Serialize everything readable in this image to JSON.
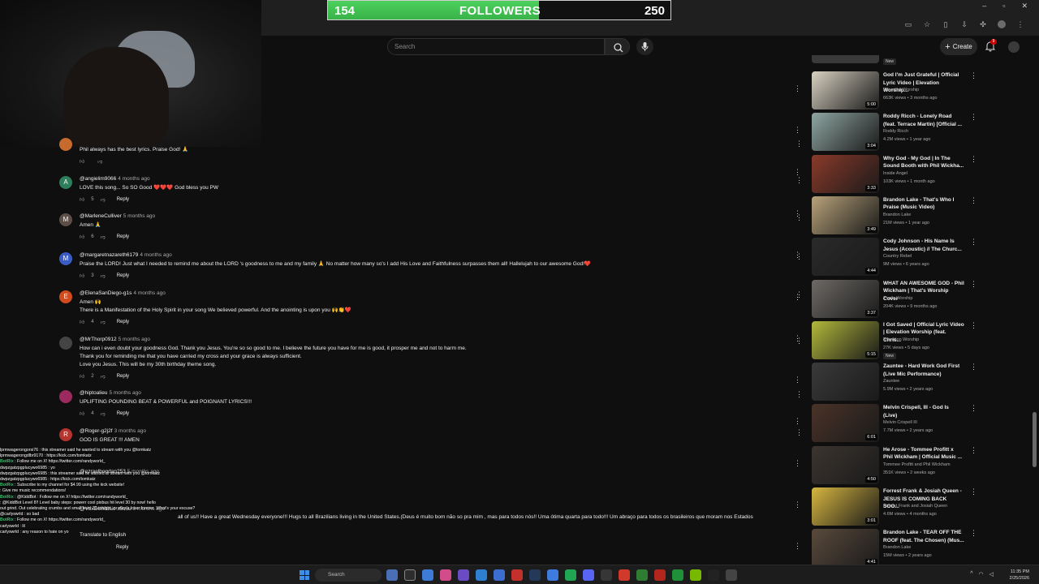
{
  "overlay": {
    "followers": {
      "current": "154",
      "label": "FOLLOWERS",
      "goal": "250",
      "progress": 0.616
    }
  },
  "header": {
    "search_placeholder": "Search",
    "create_label": "Create",
    "notification_count": "9"
  },
  "comments": [
    {
      "user": "",
      "time": "",
      "text": [
        "Phil always has the best lyrics. Praise God! 🙏"
      ],
      "likes": "",
      "initial": "",
      "color": "#c66a2e"
    },
    {
      "user": "@angielim9066",
      "time": "4 months ago",
      "text": [
        "LOVE this song... So SO Good ❤️❤️❤️ God bless you PW"
      ],
      "likes": "5",
      "initial": "A",
      "color": "#2e7d5b"
    },
    {
      "user": "@MarleneCulliver",
      "time": "5 months ago",
      "text": [
        "Amen 🙏"
      ],
      "likes": "6",
      "initial": "M",
      "color": "#5d4e48"
    },
    {
      "user": "@margaretnazareth6179",
      "time": "4 months ago",
      "text": [
        "Praise the LORD! Just what I needed to remind me about the LORD 's goodness to me and my family 🙏 No matter how many so's I add His Love and Faithfulness surpasses them all! Hallelujah to our awesome God!❤️"
      ],
      "likes": "3",
      "initial": "M",
      "color": "#3b5cc4"
    },
    {
      "user": "@ElenaSanDiego-g1s",
      "time": "4 months ago",
      "text": [
        "Amen 🙌",
        "There is a Manifestation of the Holy Spirit in your song We believed powerful. And the anointing is upon you 🙌👏❤️"
      ],
      "likes": "4",
      "initial": "E",
      "color": "#d14b1f"
    },
    {
      "user": "@MrThorp0912",
      "time": "5 months ago",
      "text": [
        "How can i even doubt your goodness God. Thank you Jesus. You're so so good to me. I believe the future you have for me is good, it prosper me and not to harm me.",
        "Thank you for reminding me that you have carried my cross and your grace is always sufficient.",
        "Love you Jesus. This will be my 30th birthday theme song."
      ],
      "likes": "2",
      "initial": "",
      "color": "#444"
    },
    {
      "user": "@hiptoalieu",
      "time": "5 months ago",
      "text": [
        "UPLIFTING POUNDING BEAT & POWERFUL and POIGNANT LYRICS!!!"
      ],
      "likes": "4",
      "initial": "",
      "color": "#9c2a5e"
    },
    {
      "user": "@Roger-g2j2f",
      "time": "3 months ago",
      "text": [
        "GOD IS GREAT !!! AMEN"
      ],
      "likes": "",
      "initial": "R",
      "color": "#b5342e"
    }
  ],
  "comments_extra": {
    "user1": "@ezraelbogdan253",
    "user1_time": "5 months ago",
    "user2": "@VoxDeiMusic-x5c6u",
    "user2_time": "3 months ago",
    "long_text": "all of us!! Have a great Wednesday everyone!!! Hugs to all Brazilians living in the United States.(Deus é muito bom não so pra mim , mas para todos nós!! Uma ótima  quarta para todo!!! Um abraço para todos os brasileiros que moram nos Estados",
    "translate": "Translate to English",
    "reply": "Reply"
  },
  "sidebar": [
    {
      "title": "God I'm Just Grateful | Official Lyric Video | Elevation Worship...",
      "channel": "Elevation Worship",
      "meta": "663K views • 3 months ago",
      "duration": "5:00",
      "badge": "",
      "thumb": "#d9d2c2"
    },
    {
      "title": "Roddy Ricch - Lonely Road (feat. Terrace Martin) [Official ...",
      "channel": "Roddy Ricch",
      "meta": "4.2M views • 1 year ago",
      "duration": "3:04",
      "badge": "",
      "thumb": "#8fa6a2"
    },
    {
      "title": "Why God - My God | In The Sound Booth with Phil Wickha...",
      "channel": "Inside Angel",
      "meta": "103K views • 1 month ago",
      "duration": "3:33",
      "badge": "",
      "thumb": "#8b3a2a"
    },
    {
      "title": "Brandon Lake - That's Who I Praise (Music Video)",
      "channel": "Brandon Lake",
      "meta": "21M views • 1 year ago",
      "duration": "3:49",
      "badge": "",
      "thumb": "#b8a27a"
    },
    {
      "title": "Cody Johnson - His Name Is Jesus (Acoustic) // The Churc...",
      "channel": "Country Rebel",
      "meta": "9M views • 6 years ago",
      "duration": "4:44",
      "badge": "",
      "thumb": "#2a2a2a"
    },
    {
      "title": "WHAT AN AWESOME GOD - Phil Wickham | That's Worship Cover",
      "channel": "That's Worship",
      "meta": "204K views • 9 months ago",
      "duration": "3:37",
      "badge": "",
      "thumb": "#6e6a66"
    },
    {
      "title": "I Got Saved | Official Lyric Video | Elevation Worship (feat. Chris...",
      "channel": "Elevation Worship",
      "meta": "27K views • 5 days ago",
      "duration": "5:15",
      "badge": "New",
      "thumb": "#b2b83a"
    },
    {
      "title": "Zauntee - Hard Work God First (Live Mic Performance)",
      "channel": "Zauntee",
      "meta": "5.9M views • 2 years ago",
      "duration": "",
      "badge": "",
      "thumb": "#3a3a3a"
    },
    {
      "title": "Melvin Crispell, III - God Is (Live)",
      "channel": "Melvin Crispell III",
      "meta": "7.7M views • 2 years ago",
      "duration": "6:01",
      "badge": "",
      "thumb": "#4a3328"
    },
    {
      "title": "He Arose - Tommee Profitt x Phil Wickham | Official Music ...",
      "channel": "Tommee Profitt and Phil Wickham",
      "meta": "351K views • 2 weeks ago",
      "duration": "4:50",
      "badge": "",
      "thumb": "#3c3530"
    },
    {
      "title": "Forrest Frank & Josiah Queen - JESUS IS COMING BACK SOO...",
      "channel": "Forrest Frank and Josiah Queen",
      "meta": "4.6M views • 4 months ago",
      "duration": "3:01",
      "badge": "",
      "thumb": "#d7b640"
    },
    {
      "title": "Brandon Lake - TEAR OFF THE ROOF (feat. The Chosen) (Mus...",
      "channel": "Brandon Lake",
      "meta": "15M views • 2 years ago",
      "duration": "4:41",
      "badge": "",
      "thumb": "#5a4a3c"
    }
  ],
  "top_badge": "New",
  "chat": [
    {
      "user": "",
      "text": "lprmwagerongorsi76 : this streamer said he wanted to stream with you @tomkatz",
      "color": "#ffffff"
    },
    {
      "user": "",
      "text": "lprmwagerongdlbr9170 : https://kick.com/tomkatz",
      "color": "#ffffff"
    },
    {
      "user": "BotRix",
      "text": ": Follow me on X! https://twitter.com/randyworld_",
      "color": "#36c26b"
    },
    {
      "user": "",
      "text": "dwpzgatzpgplucywo6985 : yo",
      "color": "#ffffff"
    },
    {
      "user": "",
      "text": "dwpzgatzpgplucywo6985 : this streamer said he wanted to stream with you @tomkatz",
      "color": "#ffffff"
    },
    {
      "user": "",
      "text": "dwpzgatzpgplucywo6985 : https://kick.com/tomkatz",
      "color": "#ffffff"
    },
    {
      "user": "BotRix",
      "text": ": Subscribe to my channel for $4.99 using the kick website!",
      "color": "#36c26b"
    },
    {
      "user": "",
      "text": ": Give me music recommendations!",
      "color": "#ffffff"
    },
    {
      "user": "BotRix",
      "text": ": @KiddBot : Follow me on X! https://twitter.com/randyworld_",
      "color": "#36c26b"
    },
    {
      "user": "",
      "text": ": @KiddBot Level 8!! Level baby steps: powerr cool pixbus hit level 30 by now! hello",
      "color": "#ffffff"
    },
    {
      "user": "",
      "text": "out grind. Out celebrating crumbs and small level 30 tonight, or stay a loser forever. What's your excuse?",
      "color": "#ffffff"
    },
    {
      "user": "",
      "text": "@carlyswrld : so bad",
      "color": "#ffffff"
    },
    {
      "user": "BotRix",
      "text": ": Follow me on X! https://twitter.com/randyworld_",
      "color": "#36c26b"
    },
    {
      "user": "",
      "text": "carlyswrld : lil",
      "color": "#ffffff"
    },
    {
      "user": "",
      "text": "carlyswrld : any reason to hate on yo",
      "color": "#ffffff"
    }
  ],
  "taskbar": {
    "search": "Search",
    "time": "11:35 PM",
    "date": "2/25/2026"
  }
}
